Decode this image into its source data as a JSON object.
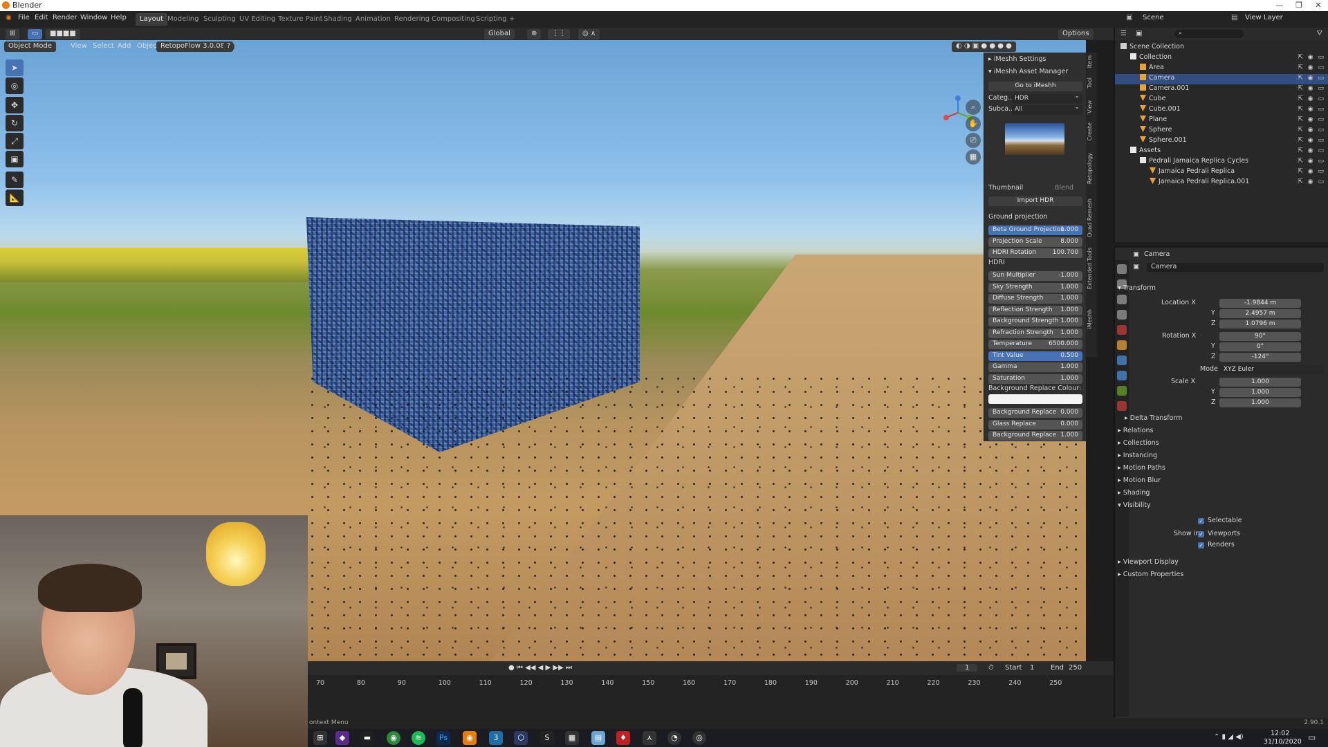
{
  "window": {
    "title": "Blender"
  },
  "menubar": {
    "menus": [
      "File",
      "Edit",
      "Render",
      "Window",
      "Help"
    ],
    "workspaces": [
      "Layout",
      "Modeling",
      "Sculpting",
      "UV Editing",
      "Texture Paint",
      "Shading",
      "Animation",
      "Rendering",
      "Compositing",
      "Scripting",
      "+"
    ],
    "active_workspace": "Layout",
    "scene": "Scene",
    "view_layer": "View Layer"
  },
  "header3d": {
    "transform_orientation": "Global",
    "options": "Options"
  },
  "viewport_header": {
    "mode": "Object Mode",
    "menus": [
      "View",
      "Select",
      "Add",
      "Object"
    ],
    "addon": "RetopoFlow 3.0.082"
  },
  "npanel": {
    "settings_title": "iMeshh Settings",
    "asset_manager_title": "iMeshh Asset Manager",
    "goto_label": "Go to iMeshh",
    "category_label": "Categ...",
    "category_value": "HDR",
    "subcategory_label": "Subca...",
    "subcategory_value": "All",
    "thumbnail_label": "Thumbnail",
    "blend_label": "Blend",
    "import_label": "Import HDR",
    "ground_projection_label": "Ground projection",
    "ground_fields": [
      {
        "label": "Beta Ground Projection",
        "value": "1.000",
        "highlight": true
      },
      {
        "label": "Projection Scale",
        "value": "8.000",
        "highlight": false
      },
      {
        "label": "HDRI Rotation",
        "value": "100.700",
        "highlight": false
      }
    ],
    "hdri_label": "HDRI",
    "hdri_fields": [
      {
        "label": "Sun Multiplier",
        "value": "-1.000",
        "highlight": false
      },
      {
        "label": "Sky Strength",
        "value": "1.000",
        "highlight": false
      },
      {
        "label": "Diffuse Strength",
        "value": "1.000",
        "highlight": false
      },
      {
        "label": "Reflection Strength",
        "value": "1.000",
        "highlight": false
      },
      {
        "label": "Background Strength",
        "value": "1.000",
        "highlight": false
      },
      {
        "label": "Refraction Strength",
        "value": "1.000",
        "highlight": false
      },
      {
        "label": "Temperature",
        "value": "6500.000",
        "highlight": false
      },
      {
        "label": "Tint Value",
        "value": "0.500",
        "highlight": true
      },
      {
        "label": "Gamma",
        "value": "1.000",
        "highlight": false
      },
      {
        "label": "Saturation",
        "value": "1.000",
        "highlight": false
      }
    ],
    "bg_colour_label": "Background Replace Colour:",
    "bottom_fields": [
      {
        "label": "Background Replace",
        "value": "0.000"
      },
      {
        "label": "Glass Replace",
        "value": "0.000"
      },
      {
        "label": "Background Replace",
        "value": "1.000"
      }
    ],
    "tabs": [
      "Item",
      "Tool",
      "View",
      "Create",
      "Retopology",
      "Quad Remesh",
      "Extended Tools",
      "iMeshh"
    ]
  },
  "timeline": {
    "current_frame": "1",
    "start_label": "Start",
    "start": "1",
    "end_label": "End",
    "end": "250",
    "ticks": [
      "70",
      "80",
      "90",
      "100",
      "110",
      "120",
      "130",
      "140",
      "150",
      "160",
      "170",
      "180",
      "190",
      "200",
      "210",
      "220",
      "230",
      "240",
      "250"
    ]
  },
  "statusbar": {
    "left": "ontext Menu",
    "version": "2.90.1"
  },
  "taskbar": {
    "time": "12:02",
    "date": "31/10/2020"
  },
  "outliner": {
    "rows": [
      {
        "label": "Scene Collection",
        "indent": 0,
        "kind": "scene",
        "selected": false
      },
      {
        "label": "Collection",
        "indent": 1,
        "kind": "collection",
        "selected": false
      },
      {
        "label": "Area",
        "indent": 2,
        "kind": "light",
        "selected": false
      },
      {
        "label": "Camera",
        "indent": 2,
        "kind": "camera",
        "selected": true
      },
      {
        "label": "Camera.001",
        "indent": 2,
        "kind": "camera",
        "selected": false
      },
      {
        "label": "Cube",
        "indent": 2,
        "kind": "mesh",
        "selected": false
      },
      {
        "label": "Cube.001",
        "indent": 2,
        "kind": "mesh",
        "selected": false
      },
      {
        "label": "Plane",
        "indent": 2,
        "kind": "mesh",
        "selected": false
      },
      {
        "label": "Sphere",
        "indent": 2,
        "kind": "mesh",
        "selected": false
      },
      {
        "label": "Sphere.001",
        "indent": 2,
        "kind": "mesh",
        "selected": false
      },
      {
        "label": "Assets",
        "indent": 1,
        "kind": "collection",
        "selected": false
      },
      {
        "label": "Pedrali Jamaica Replica Cycles",
        "indent": 2,
        "kind": "collection",
        "selected": false
      },
      {
        "label": "Jamaica Pedrali Replica",
        "indent": 3,
        "kind": "mesh",
        "selected": false
      },
      {
        "label": "Jamaica Pedrali Replica.001",
        "indent": 3,
        "kind": "mesh",
        "selected": false
      }
    ]
  },
  "properties": {
    "header_object": "Camera",
    "object_name": "Camera",
    "transform_label": "Transform",
    "location_label": "Location X",
    "location": [
      "-1.9844 m",
      "2.4957 m",
      "1.0796 m"
    ],
    "rotation_label": "Rotation X",
    "rotation": [
      "90°",
      "0°",
      "-124°"
    ],
    "mode_label": "Mode",
    "mode_value": "XYZ Euler",
    "scale_label": "Scale X",
    "scale": [
      "1.000",
      "1.000",
      "1.000"
    ],
    "axis_y": "Y",
    "axis_z": "Z",
    "delta_transform": "Delta Transform",
    "sections": [
      "Relations",
      "Collections",
      "Instancing",
      "Motion Paths",
      "Motion Blur",
      "Shading",
      "Visibility"
    ],
    "selectable_label": "Selectable",
    "show_in_label": "Show in",
    "viewports_label": "Viewports",
    "renders_label": "Renders",
    "viewport_display": "Viewport Display",
    "custom_properties": "Custom Properties"
  },
  "colors": {
    "accent": "#4772b3",
    "selected_row": "#334d80",
    "blender_orange": "#e87d0d"
  }
}
